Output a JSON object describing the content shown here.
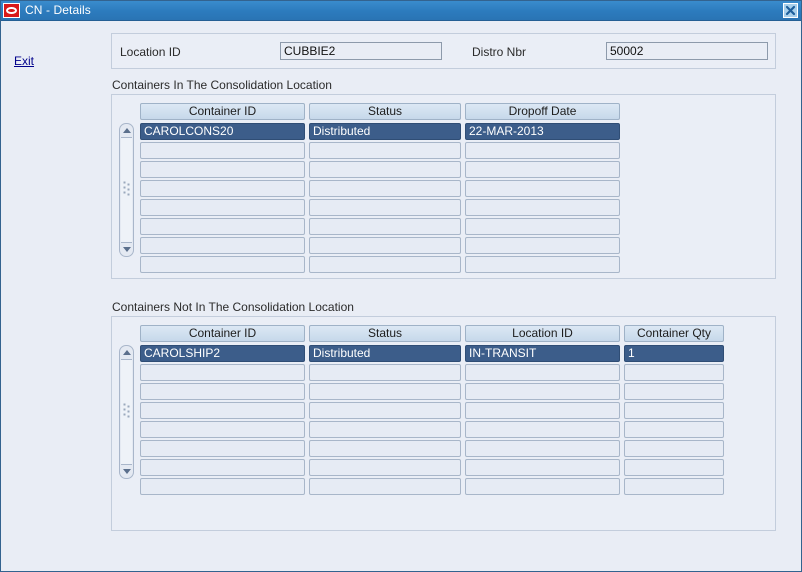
{
  "window": {
    "title": "CN - Details",
    "logo_icon": "oracle-logo-icon",
    "close_icon": "close-icon",
    "accent_color": "#2c7bbd",
    "selection_color": "#3c5d8a",
    "background_color": "#e9edf5"
  },
  "nav": {
    "exit_label": "Exit"
  },
  "header": {
    "location_id_label": "Location ID",
    "location_id_value": "CUBBIE2",
    "distro_nbr_label": "Distro Nbr",
    "distro_nbr_value": "50002"
  },
  "sections": [
    {
      "caption": "Containers In The Consolidation Location",
      "columns": [
        "Container ID",
        "Status",
        "Dropoff Date"
      ],
      "rows": [
        {
          "selected": true,
          "cells": [
            "CAROLCONS20",
            "Distributed",
            "22-MAR-2013"
          ]
        },
        {
          "selected": false,
          "cells": [
            "",
            "",
            ""
          ]
        },
        {
          "selected": false,
          "cells": [
            "",
            "",
            ""
          ]
        },
        {
          "selected": false,
          "cells": [
            "",
            "",
            ""
          ]
        },
        {
          "selected": false,
          "cells": [
            "",
            "",
            ""
          ]
        },
        {
          "selected": false,
          "cells": [
            "",
            "",
            ""
          ]
        },
        {
          "selected": false,
          "cells": [
            "",
            "",
            ""
          ]
        },
        {
          "selected": false,
          "cells": [
            "",
            "",
            ""
          ]
        }
      ],
      "scrollbar": {
        "up_icon": "scroll-up-arrow-icon",
        "down_icon": "scroll-down-arrow-icon"
      }
    },
    {
      "caption": "Containers Not In The Consolidation Location",
      "columns": [
        "Container ID",
        "Status",
        "Location ID",
        "Container Qty"
      ],
      "rows": [
        {
          "selected": true,
          "cells": [
            "CAROLSHIP2",
            "Distributed",
            "IN-TRANSIT",
            "1"
          ]
        },
        {
          "selected": false,
          "cells": [
            "",
            "",
            "",
            ""
          ]
        },
        {
          "selected": false,
          "cells": [
            "",
            "",
            "",
            ""
          ]
        },
        {
          "selected": false,
          "cells": [
            "",
            "",
            "",
            ""
          ]
        },
        {
          "selected": false,
          "cells": [
            "",
            "",
            "",
            ""
          ]
        },
        {
          "selected": false,
          "cells": [
            "",
            "",
            "",
            ""
          ]
        },
        {
          "selected": false,
          "cells": [
            "",
            "",
            "",
            ""
          ]
        },
        {
          "selected": false,
          "cells": [
            "",
            "",
            "",
            ""
          ]
        }
      ],
      "scrollbar": {
        "up_icon": "scroll-up-arrow-icon",
        "down_icon": "scroll-down-arrow-icon"
      }
    }
  ]
}
